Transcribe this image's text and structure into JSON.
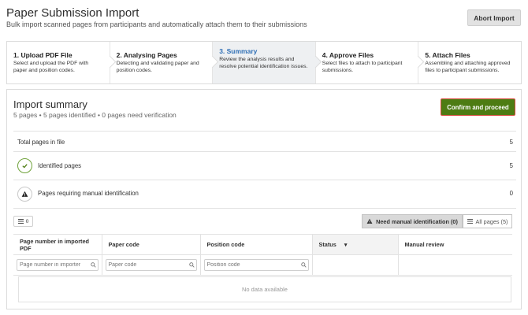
{
  "header": {
    "title": "Paper Submission Import",
    "subtitle": "Bulk import scanned pages from participants and automatically attach them to their submissions",
    "abort_label": "Abort Import"
  },
  "steps": [
    {
      "title": "1. Upload PDF File",
      "desc": "Select and upload the PDF with paper and position codes."
    },
    {
      "title": "2. Analysing Pages",
      "desc": "Detecting and validating paper and position codes."
    },
    {
      "title": "3. Summary",
      "desc": "Review the analysis results and resolve potential identification issues.",
      "active": true
    },
    {
      "title": "4. Approve Files",
      "desc": "Select files to attach to participant submissions."
    },
    {
      "title": "5. Attach Files",
      "desc": "Assembling and attaching approved files to participant submissions."
    }
  ],
  "summary": {
    "title": "Import summary",
    "subtitle": "5 pages • 5 pages identified • 0 pages need verification",
    "confirm_label": "Confirm and proceed",
    "stats": [
      {
        "label": "Total pages in file",
        "value": "5"
      },
      {
        "label": "Identified pages",
        "value": "5",
        "icon": "check-icon"
      },
      {
        "label": "Pages requiring manual identification",
        "value": "0",
        "icon": "warning-icon"
      }
    ]
  },
  "toolbar": {
    "columns_count": "0",
    "filter_need": "Need manual identification (0)",
    "filter_all": "All pages (5)"
  },
  "table": {
    "columns": [
      "Page number in imported PDF",
      "Paper code",
      "Position code",
      "Status",
      "Manual review"
    ],
    "filters": {
      "page_placeholder": "Page number in importer",
      "paper_placeholder": "Paper code",
      "position_placeholder": "Position code"
    },
    "empty_text": "No data available"
  },
  "colors": {
    "accent_green": "#4d7c13",
    "active_step_text": "#2f6fb5",
    "confirm_border": "#d74a3d"
  }
}
